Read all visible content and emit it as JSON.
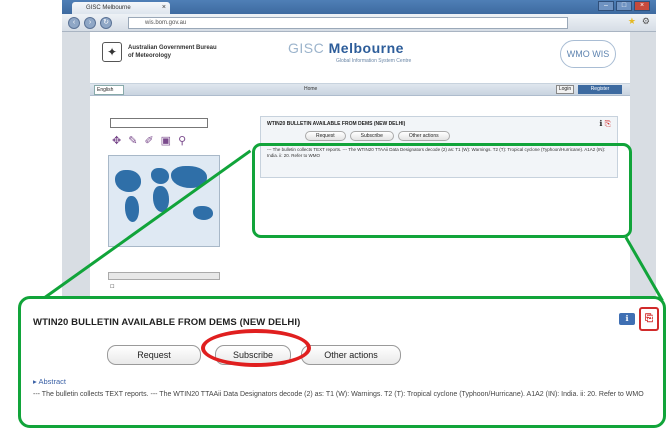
{
  "browser": {
    "tab_title": "GISC Melbourne",
    "url": "wis.bom.gov.au"
  },
  "site": {
    "gov_name": "Australian Government Bureau of Meteorology",
    "gisc_prefix": "GISC",
    "gisc_name": "Melbourne",
    "gisc_subtitle": "Global Information System Centre",
    "wmo_logo": "WMO WIS",
    "nav": {
      "language": "English",
      "home": "Home",
      "login": "Login",
      "register": "Register"
    }
  },
  "sidebar": {
    "title": "",
    "search_label": "",
    "search_value": ""
  },
  "content": {
    "welcome": "",
    "results_info": ""
  },
  "result": {
    "title": "WTIN20 BULLETIN AVAILABLE FROM DEMS (NEW DELHI)",
    "buttons": {
      "request": "Request",
      "subscribe": "Subscribe",
      "other": "Other actions"
    },
    "abstract_label": "Abstract",
    "abstract_text": "--- The bulletin collects TEXT reports. --- The WTIN20 TTAAii Data Designators decode (2) as: T1 (W): Warnings. T2 (T): Tropical cyclone (Typhoon/Hurricane). A1A2 (IN): India. ii: 20. Refer to WMO"
  },
  "colors": {
    "highlight_green": "#11a43a",
    "highlight_red": "#e01f1f",
    "accent_blue": "#3d6aa0"
  }
}
